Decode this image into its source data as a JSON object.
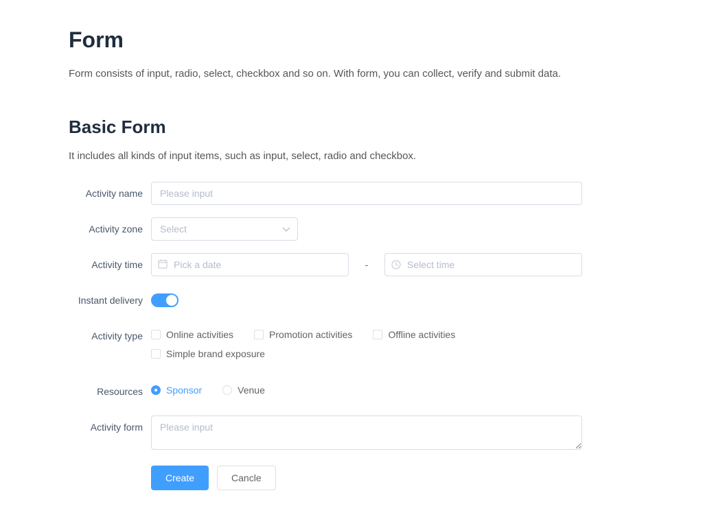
{
  "page": {
    "title": "Form",
    "intro": "Form consists of input, radio, select, checkbox and so on. With form, you can collect, verify and submit data."
  },
  "section": {
    "title": "Basic Form",
    "intro": "It includes all kinds of input items, such as input, select, radio and checkbox."
  },
  "labels": {
    "activity_name": "Activity name",
    "activity_zone": "Activity zone",
    "activity_time": "Activity time",
    "instant_delivery": "Instant delivery",
    "activity_type": "Activity type",
    "resources": "Resources",
    "activity_form": "Activity form"
  },
  "fields": {
    "name_placeholder": "Please input",
    "zone_placeholder": "Select",
    "date_placeholder": "Pick a date",
    "time_placeholder": "Select time",
    "time_separator": "-",
    "form_placeholder": "Please input"
  },
  "activity_types": {
    "online": "Online activities",
    "promotion": "Promotion activities",
    "offline": "Offline activities",
    "brand": "Simple brand exposure"
  },
  "resources": {
    "sponsor": "Sponsor",
    "venue": "Venue",
    "selected": "sponsor"
  },
  "buttons": {
    "create": "Create",
    "cancel": "Cancle"
  },
  "switch": {
    "instant_delivery_on": true
  }
}
